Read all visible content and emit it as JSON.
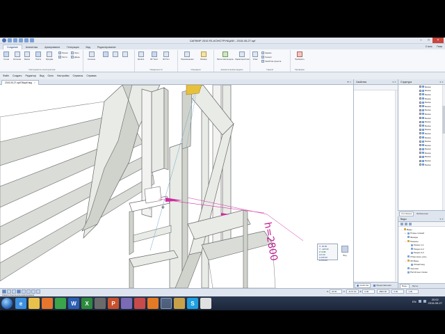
{
  "window": {
    "title": "САПФИР 2015 R1-КОНСТРУКЦИИ - 2015-05-27.spf"
  },
  "ribbon_tabs": [
    "Создание",
    "Аналитика",
    "Армирование",
    "Генерация",
    "Вид",
    "Редактирование"
  ],
  "ribbon_right": [
    "Стиль",
    "Тема"
  ],
  "ribbon": {
    "g1_items": [
      "Стена",
      "Колонна",
      "Балка",
      "Плита",
      "Фундам."
    ],
    "g1_small": [
      "Проем",
      "Лестн.",
      "Окно",
      "Дверь"
    ],
    "g1_title": "Инструменты конструктора",
    "g2_items": [
      "Сечение"
    ],
    "g3_items": [
      "Кровля",
      "3D Текст",
      "3D Пол"
    ],
    "g3_title": "Поверхности",
    "g4_items": [
      "Перемещение",
      "Размер"
    ],
    "g4_title": "Операции",
    "g5_items": [
      "Расчетная модель",
      "Характеристики"
    ],
    "g5_title": "Аналитическая модель",
    "g6_items": [
      "Этаж"
    ],
    "g6_small": [
      "Здание",
      "Секция",
      "Свойства проекта"
    ],
    "g6_title": "Проект",
    "g7_items": [
      "Проверить"
    ],
    "g7_title": "Проверка"
  },
  "menu": [
    "Файл",
    "Создать",
    "Редактор",
    "Вид",
    "Окно",
    "Настройки",
    "Сервисы",
    "Справка"
  ],
  "doc_tab": {
    "label": "2015-05-27.spf/Общий вид"
  },
  "viewport": {
    "dimension_label": "h=2800",
    "coords": {
      "x_label": "X:",
      "x": "18.00",
      "y_label": "Y:",
      "y": "-118.00",
      "z_label": "Z:",
      "z": "0.00",
      "dx": "0.00",
      "dy": "105.00",
      "dz": "155.00"
    },
    "navcube": "Вид"
  },
  "properties": {
    "title": "Свойства",
    "tabs": [
      "Свойства",
      "Представления"
    ]
  },
  "structure": {
    "title": "Структура",
    "item_label": "Балка",
    "rows": 21,
    "tabs": [
      "Составные",
      "Библиотеки"
    ]
  },
  "views": {
    "title": "Виды",
    "tree": [
      {
        "indent": 0,
        "toggle": "−",
        "type": "folder",
        "label": "Виды"
      },
      {
        "indent": 1,
        "toggle": "+",
        "type": "view",
        "label": "Планы этажей"
      },
      {
        "indent": 1,
        "toggle": "",
        "type": "view",
        "label": "Фасады"
      },
      {
        "indent": 1,
        "toggle": "−",
        "type": "folder",
        "label": "Разрезы"
      },
      {
        "indent": 2,
        "toggle": "",
        "type": "view",
        "label": "Разрез 1-1"
      },
      {
        "indent": 2,
        "toggle": "",
        "type": "view",
        "label": "Разрез 2-2"
      },
      {
        "indent": 2,
        "toggle": "",
        "type": "view",
        "label": "Разрез 3-3"
      },
      {
        "indent": 1,
        "toggle": "",
        "type": "view",
        "label": "Сборочные узлы"
      },
      {
        "indent": 1,
        "toggle": "−",
        "type": "folder",
        "label": "3D Виды"
      },
      {
        "indent": 2,
        "toggle": "",
        "type": "view",
        "label": "Общий вид"
      },
      {
        "indent": 1,
        "toggle": "",
        "type": "view",
        "label": "Чертежи"
      },
      {
        "indent": 1,
        "toggle": "",
        "type": "view",
        "label": "Расчётные схемы"
      }
    ],
    "tabs": [
      "Виды",
      "Листы"
    ]
  },
  "status": {
    "hint": "Укажите объекты для редактирования",
    "fields": [
      {
        "label": "X:",
        "value": "18.00"
      },
      {
        "label": "Y:",
        "value": "-4172.00"
      },
      {
        "label": "Z:",
        "value": "0.00"
      },
      {
        "label": "",
        "value": "2800.00"
      },
      {
        "label": "",
        "value": "0.00"
      },
      {
        "label": "",
        "value": "1.00"
      }
    ]
  },
  "taskbar": {
    "icons": [
      "ie-icon",
      "explorer-icon",
      "media-icon",
      "chrome-icon",
      "word-icon",
      "excel-icon",
      "unknown-icon",
      "powerpoint-icon",
      "app-icon",
      "app2-icon",
      "firefox-icon",
      "sapfir-icon",
      "folder-icon",
      "skype-icon",
      "notes-icon"
    ],
    "icon_letters": [
      "e",
      "",
      "",
      "",
      "W",
      "X",
      "",
      "P",
      "",
      "",
      "",
      "",
      "",
      "S",
      ""
    ],
    "icon_colors": [
      "#3d8fe0",
      "#e8c14a",
      "#e6762e",
      "#3aa54a",
      "#2b5fb3",
      "#2d8a3e",
      "#6a6a6a",
      "#c8512d",
      "#7b6bb5",
      "#c94a4a",
      "#e57a24",
      "#5d86c7",
      "#c7a14a",
      "#1ea0e0",
      "#e0e0e0"
    ],
    "lang": "EN",
    "time": "20:02",
    "date": "2015-05-27"
  }
}
